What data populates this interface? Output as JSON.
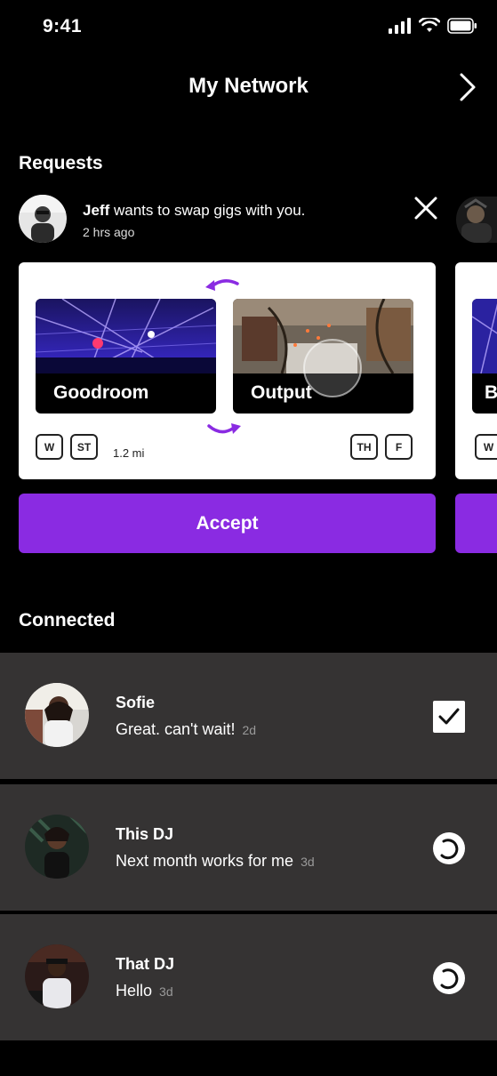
{
  "status_bar": {
    "time": "9:41"
  },
  "header": {
    "title": "My Network"
  },
  "requests": {
    "title": "Requests",
    "item": {
      "user": "Jeff",
      "action": "wants to swap gigs with you.",
      "time": "2 hrs ago",
      "from_venue": "Goodroom",
      "to_venue": "Output",
      "from_days": [
        "W",
        "ST"
      ],
      "to_days": [
        "TH",
        "F"
      ],
      "distance": "1.2 mi",
      "accept_label": "Accept"
    },
    "peek": {
      "venue_initial": "B",
      "day": "W"
    }
  },
  "connected": {
    "title": "Connected",
    "items": [
      {
        "name": "Sofie",
        "message": "Great. can't wait!",
        "time": "2d",
        "status": "confirmed-checkbox-icon"
      },
      {
        "name": "This DJ",
        "message": "Next month works for me",
        "time": "3d",
        "status": "pending-spinner-icon"
      },
      {
        "name": "That DJ",
        "message": "Hello",
        "time": "3d",
        "status": "pending-spinner-icon"
      }
    ]
  },
  "colors": {
    "accent": "#8a2be2",
    "background": "#000000",
    "row": "#353333"
  }
}
